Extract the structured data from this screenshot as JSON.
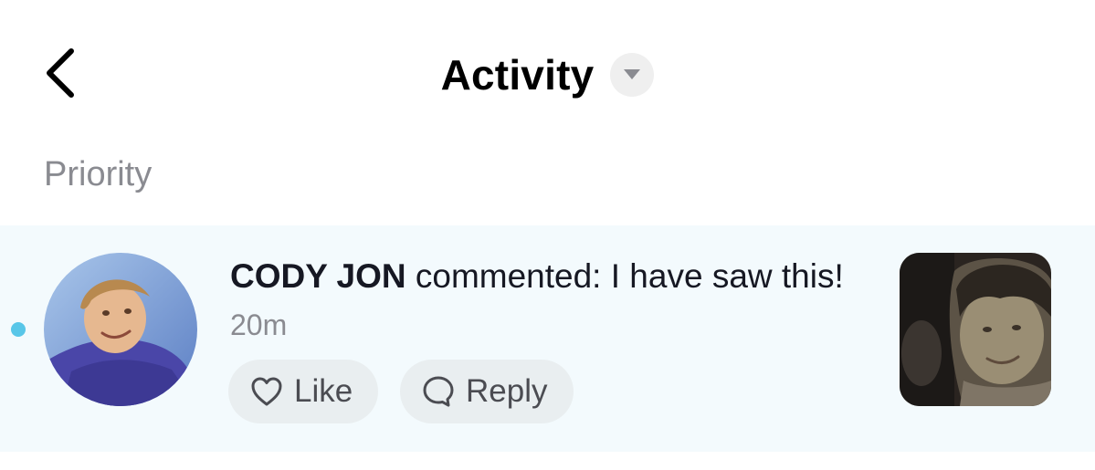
{
  "header": {
    "title": "Activity",
    "back_icon": "chevron-left-icon",
    "filter_icon": "caret-down-icon"
  },
  "section": {
    "label": "Priority"
  },
  "notification": {
    "username": "CODY JON",
    "action_text": " commented: I have saw this!",
    "time": "20m",
    "unread": true,
    "avatar_icon": "user-avatar-photo",
    "thumbnail_icon": "video-thumbnail-photo",
    "actions": {
      "like_label": "Like",
      "like_icon": "heart-outline-icon",
      "reply_label": "Reply",
      "reply_icon": "speech-bubble-icon"
    }
  },
  "colors": {
    "row_background": "#f3fafd",
    "unread_dot": "#58c6e8",
    "muted_text": "#8a8b91",
    "button_background": "#e9eef0"
  }
}
